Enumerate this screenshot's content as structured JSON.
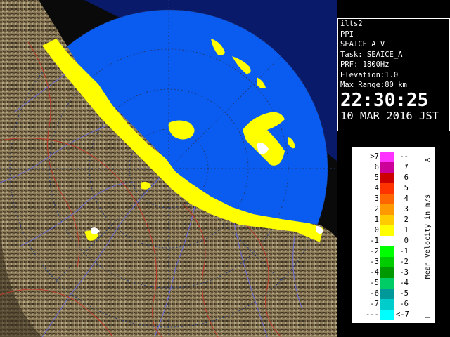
{
  "info": {
    "site": "ilts2",
    "scan_type": "PPI",
    "product": "SEAICE_A_V",
    "task": "Task: SEAICE_A",
    "prf": "PRF: 1800Hz",
    "elevation": "Elevation:1.0",
    "max_range": "Max Range:80 km",
    "time": "22:30:25",
    "date": "10 MAR 2016 JST"
  },
  "legend": {
    "title": "Mean Velocity in m/s",
    "top_marker": "A",
    "bottom_marker": "T",
    "rows": [
      {
        "left": ">7",
        "right": "---",
        "color": "#ff33ff"
      },
      {
        "left": "6",
        "right": "7",
        "color": "#cc0099"
      },
      {
        "left": "5",
        "right": "6",
        "color": "#cc0000"
      },
      {
        "left": "4",
        "right": "5",
        "color": "#ff3300"
      },
      {
        "left": "3",
        "right": "4",
        "color": "#ff6600"
      },
      {
        "left": "2",
        "right": "3",
        "color": "#ff9900"
      },
      {
        "left": "1",
        "right": "2",
        "color": "#ffcc00"
      },
      {
        "left": "0",
        "right": "1",
        "color": "#ffff00"
      },
      {
        "left": "-1",
        "right": "0",
        "color": "#ffffff"
      },
      {
        "left": "-2",
        "right": "-1",
        "color": "#00ff00"
      },
      {
        "left": "-3",
        "right": "-2",
        "color": "#00cc00"
      },
      {
        "left": "-4",
        "right": "-3",
        "color": "#009900"
      },
      {
        "left": "-5",
        "right": "-4",
        "color": "#00cc66"
      },
      {
        "left": "-6",
        "right": "-5",
        "color": "#009999"
      },
      {
        "left": "-7",
        "right": "-6",
        "color": "#00cccc"
      },
      {
        "left": "---",
        "right": "<-7",
        "color": "#00ffff"
      }
    ]
  },
  "colors": {
    "sea": "#0a5cf0",
    "land": "#8a7a58",
    "ice_echo": "#ffff00",
    "rivers": "#6a6ad8",
    "borders": "#c23a2a"
  }
}
